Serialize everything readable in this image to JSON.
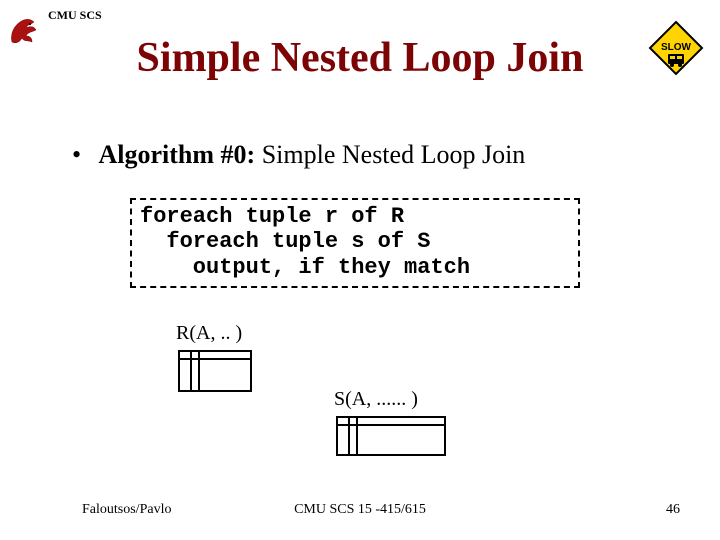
{
  "header": {
    "org": "CMU SCS"
  },
  "title": "Simple Nested Loop Join",
  "bullet": {
    "strong": "Algorithm #0:",
    "rest": " Simple Nested Loop Join"
  },
  "code": {
    "line1": "foreach tuple r of R",
    "line2": "  foreach tuple s of S",
    "line3": "    output, if they match"
  },
  "relations": {
    "r_label": "R(A, .. )",
    "s_label": "S(A, ...... )"
  },
  "footer": {
    "left": "Faloutsos/Pavlo",
    "center": "CMU SCS 15 -415/615",
    "page": "46"
  },
  "icons": {
    "griffin": "griffin-logo",
    "slow": "SLOW"
  }
}
